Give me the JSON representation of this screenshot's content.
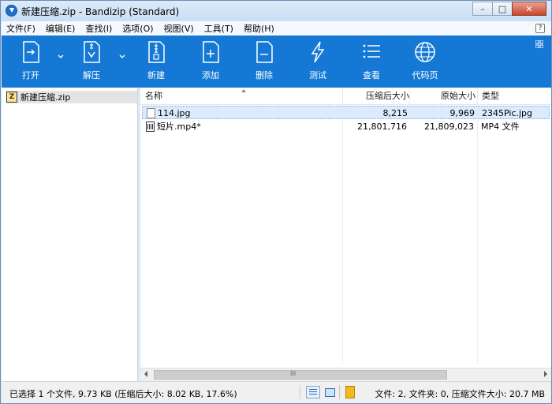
{
  "window": {
    "title": "新建压缩.zip - Bandizip (Standard)",
    "minimize": "–",
    "maximize": "□",
    "close": "✕"
  },
  "menu": {
    "items": [
      "文件(F)",
      "编辑(E)",
      "查找(I)",
      "选项(O)",
      "视图(V)",
      "工具(T)",
      "帮助(H)"
    ]
  },
  "toolbar": {
    "open": "打开",
    "extract": "解压",
    "new": "新建",
    "add": "添加",
    "delete": "删除",
    "test": "测试",
    "view": "查看",
    "codepage": "代码页"
  },
  "tree": {
    "root": "新建压缩.zip"
  },
  "columns": {
    "name": "名称",
    "compressed": "压缩后大小",
    "original": "原始大小",
    "type": "类型"
  },
  "files": [
    {
      "name": "114.jpg",
      "compressed": "8,215",
      "original": "9,969",
      "type": "2345Pic.jpg"
    },
    {
      "name": "短片.mp4*",
      "compressed": "21,801,716",
      "original": "21,809,023",
      "type": "MP4 文件"
    }
  ],
  "scrollbar": {
    "grip": "III"
  },
  "status": {
    "left": "已选择 1 个文件, 9.73 KB (压缩后大小: 8.02 KB, 17.6%)",
    "right": "文件: 2, 文件夹: 0, 压缩文件大小: 20.7 MB"
  },
  "colors": {
    "toolbar": "#1478d4",
    "selection": "#dcebfc"
  }
}
